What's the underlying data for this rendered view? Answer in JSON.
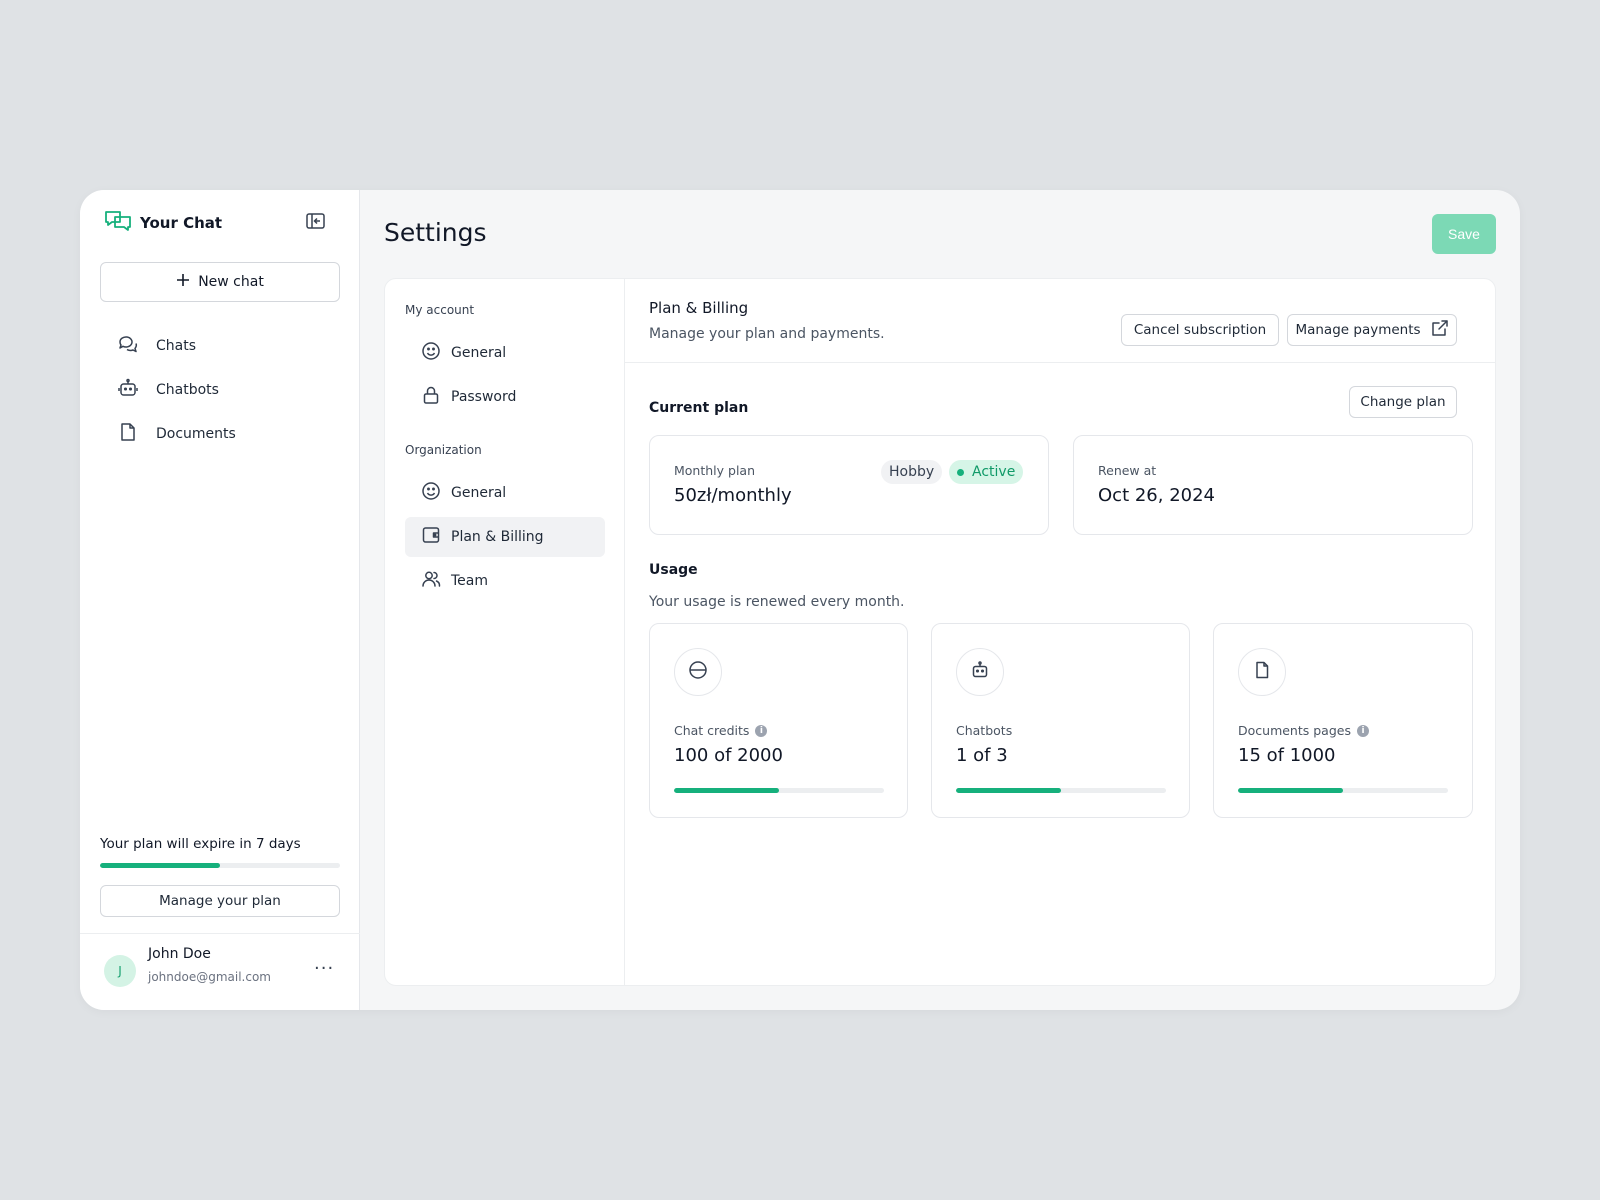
{
  "brand": {
    "name": "Your Chat"
  },
  "sidebar": {
    "new_chat_label": "New chat",
    "items": [
      {
        "label": "Chats",
        "icon": "chat-bubbles-icon"
      },
      {
        "label": "Chatbots",
        "icon": "robot-icon"
      },
      {
        "label": "Documents",
        "icon": "document-icon"
      }
    ],
    "plan_notice": "Your plan will expire in 7 days",
    "plan_progress": 0.5,
    "manage_plan_label": "Manage your plan"
  },
  "user": {
    "initial": "J",
    "name": "John Doe",
    "email": "johndoe@gmail.com",
    "more_label": "···"
  },
  "header": {
    "title": "Settings",
    "save_label": "Save"
  },
  "settings_nav": {
    "my_account_label": "My account",
    "my_account_items": [
      {
        "label": "General",
        "icon": "smiley-icon"
      },
      {
        "label": "Password",
        "icon": "lock-icon"
      }
    ],
    "organization_label": "Organization",
    "organization_items": [
      {
        "label": "General",
        "icon": "smiley-icon"
      },
      {
        "label": "Plan & Billing",
        "icon": "wallet-icon",
        "active": true
      },
      {
        "label": "Team",
        "icon": "users-icon"
      }
    ]
  },
  "billing": {
    "title": "Plan & Billing",
    "subtitle": "Manage your plan and payments.",
    "cancel_label": "Cancel subscription",
    "manage_payments_label": "Manage payments",
    "current_plan_label": "Current plan",
    "change_plan_label": "Change plan",
    "plan": {
      "label": "Monthly plan",
      "price": "50zł/monthly",
      "tier_badge": "Hobby",
      "status_badge": "Active"
    },
    "renew": {
      "label": "Renew at",
      "date": "Oct 26, 2024"
    },
    "usage_label": "Usage",
    "usage_subtitle": "Your usage is renewed every month.",
    "usage": [
      {
        "label": "Chat credits",
        "value": "100 of 2000",
        "progress": 0.5,
        "icon": "credits-icon",
        "info": true
      },
      {
        "label": "Chatbots",
        "value": "1 of 3",
        "progress": 0.5,
        "icon": "robot-icon",
        "info": false
      },
      {
        "label": "Documents pages",
        "value": "15 of 1000",
        "progress": 0.5,
        "icon": "document-icon",
        "info": true
      }
    ]
  },
  "colors": {
    "accent": "#16b07c",
    "save_button": "#7cd9b5",
    "active_badge_bg": "#d6f5e7"
  }
}
